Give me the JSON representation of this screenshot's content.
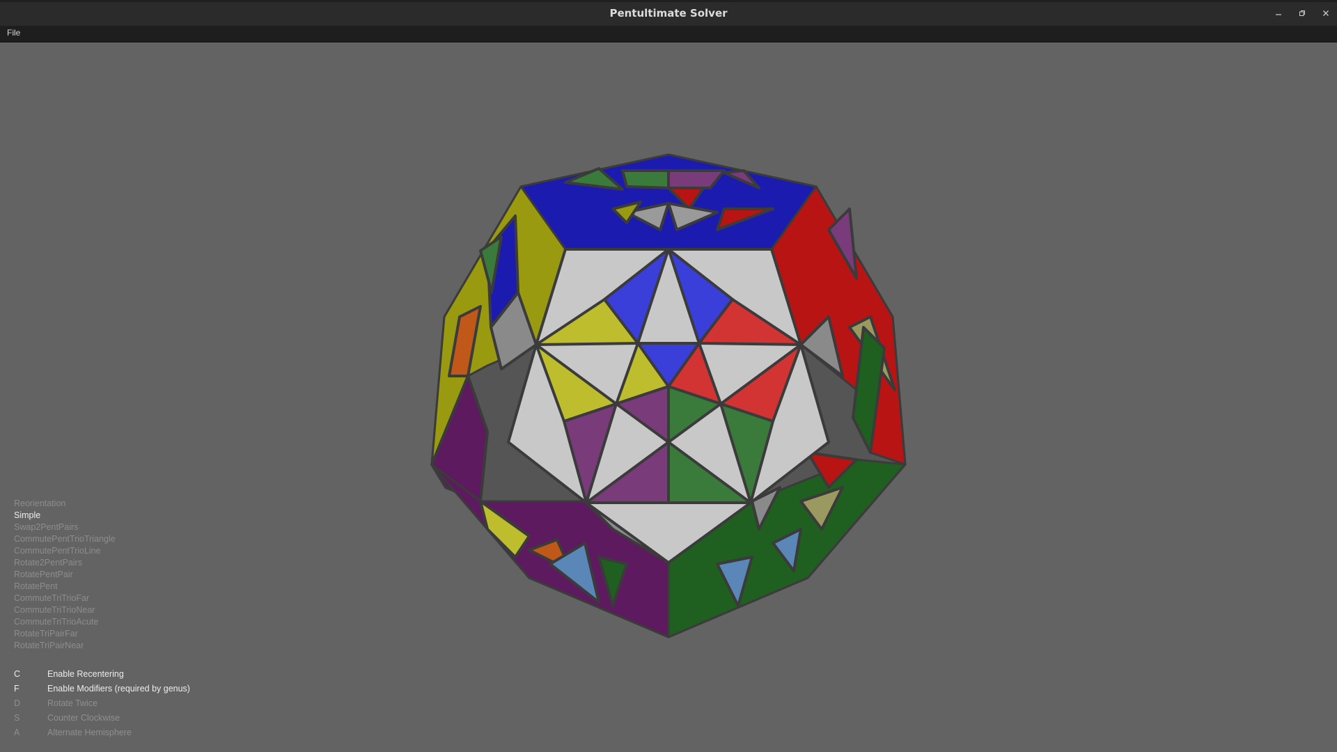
{
  "window": {
    "title": "Pentultimate Solver",
    "controls": [
      "minimize-icon",
      "restore-icon",
      "close-icon"
    ]
  },
  "menu": {
    "items": [
      "File"
    ]
  },
  "algorithms": {
    "items": [
      {
        "label": "Reorientation",
        "selected": false
      },
      {
        "label": "Simple",
        "selected": true
      },
      {
        "label": "Swap2PentPairs",
        "selected": false
      },
      {
        "label": "CommutePentTrioTriangle",
        "selected": false
      },
      {
        "label": "CommutePentTrioLine",
        "selected": false
      },
      {
        "label": "Rotate2PentPairs",
        "selected": false
      },
      {
        "label": "RotatePentPair",
        "selected": false
      },
      {
        "label": "RotatePent",
        "selected": false
      },
      {
        "label": "CommuteTriTrioFar",
        "selected": false
      },
      {
        "label": "CommuteTriTrioNear",
        "selected": false
      },
      {
        "label": "CommuteTriTrioAcute",
        "selected": false
      },
      {
        "label": "RotateTriPairFar",
        "selected": false
      },
      {
        "label": "RotateTriPairNear",
        "selected": false
      }
    ]
  },
  "shortcuts": [
    {
      "key": "C",
      "label": "Enable Recentering",
      "enabled": true
    },
    {
      "key": "F",
      "label": "Enable Modifiers (required by genus)",
      "enabled": true
    },
    {
      "key": "D",
      "label": "Rotate Twice",
      "enabled": false
    },
    {
      "key": "S",
      "label": "Counter Clockwise",
      "enabled": false
    },
    {
      "key": "A",
      "label": "Alternate Hemisphere",
      "enabled": false
    }
  ],
  "puzzle_colors": {
    "white": "#c8c8c8",
    "blue": "#3a3fd9",
    "red": "#d23434",
    "yellow": "#bdbd2e",
    "green": "#3a7a3a",
    "purple": "#7a3b7a",
    "dark_blue": "#1b1bb0",
    "dark_red": "#b81414",
    "olive": "#9a9a10",
    "dark_green": "#1f5f1f",
    "dark_purple": "#5e1a5e",
    "light_blue": "#5a86b8",
    "orange": "#c0581a",
    "edge": "#3b3b3b"
  }
}
